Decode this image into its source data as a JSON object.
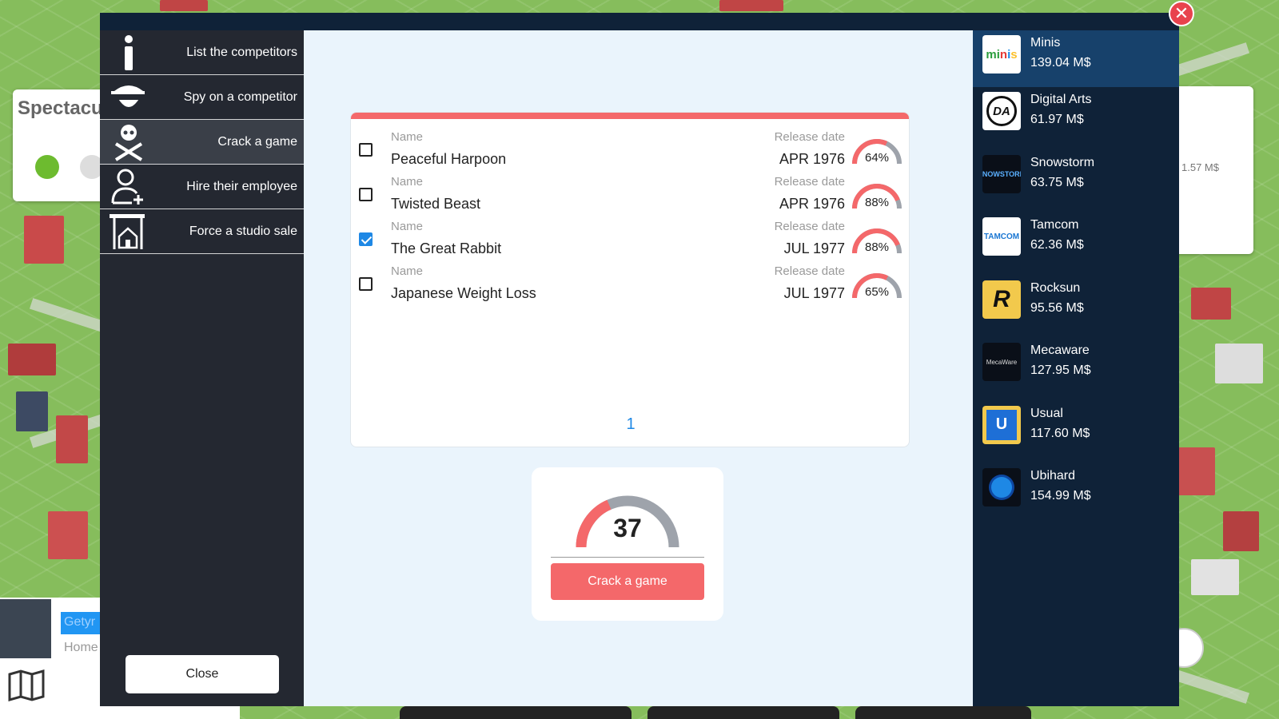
{
  "background": {
    "card_title": "Spectacu",
    "right_value": "1.57 M$",
    "bottom_tab": "Getyr",
    "bottom_label": "Home"
  },
  "window": {
    "close_icon": "close-icon"
  },
  "menu": {
    "items": [
      {
        "label": "List the competitors",
        "icon": "info-icon",
        "active": false
      },
      {
        "label": "Spy on a competitor",
        "icon": "spy-icon",
        "active": false
      },
      {
        "label": "Crack a game",
        "icon": "skull-crossbones-icon",
        "active": true
      },
      {
        "label": "Hire their employee",
        "icon": "add-user-icon",
        "active": false
      },
      {
        "label": "Force a studio sale",
        "icon": "house-sale-icon",
        "active": false
      }
    ],
    "close_label": "Close"
  },
  "games": {
    "name_label": "Name",
    "date_label": "Release date",
    "rows": [
      {
        "name": "Peaceful Harpoon",
        "date": "APR 1976",
        "pct": "64%",
        "value": 64,
        "checked": false
      },
      {
        "name": "Twisted Beast",
        "date": "APR 1976",
        "pct": "88%",
        "value": 88,
        "checked": false
      },
      {
        "name": "The Great Rabbit",
        "date": "JUL 1977",
        "pct": "88%",
        "value": 88,
        "checked": true
      },
      {
        "name": "Japanese Weight Loss",
        "date": "JUL 1977",
        "pct": "65%",
        "value": 65,
        "checked": false
      }
    ],
    "page": "1"
  },
  "crack": {
    "value": "37",
    "fraction": 0.37,
    "button_label": "Crack a game"
  },
  "colors": {
    "accent": "#f4686a",
    "gauge_bg": "#9ea3ab",
    "link": "#1e88e5",
    "panel_dark": "#0f2238",
    "menu_dark": "#242831"
  },
  "competitors": [
    {
      "name": "Minis",
      "value": "139.04 M$",
      "logo": "minis-logo",
      "active": true
    },
    {
      "name": "Digital Arts",
      "value": "61.97 M$",
      "logo": "digital-arts-logo",
      "active": false
    },
    {
      "name": "Snowstorm",
      "value": "63.75 M$",
      "logo": "snowstorm-logo",
      "active": false
    },
    {
      "name": "Tamcom",
      "value": "62.36 M$",
      "logo": "tamcom-logo",
      "active": false
    },
    {
      "name": "Rocksun",
      "value": "95.56 M$",
      "logo": "rocksun-logo",
      "active": false
    },
    {
      "name": "Mecaware",
      "value": "127.95 M$",
      "logo": "mecaware-logo",
      "active": false
    },
    {
      "name": "Usual",
      "value": "117.60 M$",
      "logo": "usual-logo",
      "active": false
    },
    {
      "name": "Ubihard",
      "value": "154.99 M$",
      "logo": "ubihard-logo",
      "active": false
    }
  ]
}
